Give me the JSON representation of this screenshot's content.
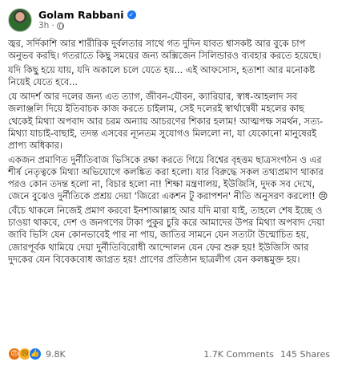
{
  "post": {
    "author": "Golam Rabbani",
    "time": "3h",
    "separator": "·",
    "verified_mark": "✓",
    "paragraphs": [
      "জ্বর, সর্দিকাশি আর শারীরিক দুর্বলতার সাথে গত দুদিন যাবত শ্বাসকষ্ট আর বুকে চাপ অনুভব করছি। গতরাতে কিছু সময়ের জন্য অক্সিজেন সিলিন্ডারও ব্যবহার করতে হয়েছে।",
      "যদি কিছু হয়ে যায়, যদি অকালে চলে যেতে হয়... এই আফসোস, হতাশা আর মনোকষ্ট নিয়েই যেতে হবে...",
      "যে আদর্শ আর দলের জন্য এত ত্যাগ, জীবন-যৌবন, ক্যারিয়ার, স্বাধ-আহলাদ সব জলাঞ্জলি দিয়ে ইতিবাচক কাজ করতে চাইলাম, সেই দলেরই স্বার্থান্বেষী মহলের কাছ থেকেই মিথ্যা অপবাদ আর চরম অন্যায় আচরণের শিকার হলাম! আত্মপক্ষ সমর্থন, সত্য-মিথ্যা যাচাই-বাছাই, তদন্ত এসবের ন্যূনতম সুযোগও মিললো না, যা যেকোনো মানুষেরই প্রাপ্য অধিকার।",
      "একজন প্রমাণিত দুর্নীতিবাজ ভিসিকে রক্ষা করতে গিয়ে বিশ্বের বৃহত্তম ছাত্রসংগঠন ও এর শীর্ষ নেতৃত্বকে মিথ্যা অভিযোগে কলঙ্কিত করা হলো। যার বিরুদ্ধে সকল তথ্যপ্রমাণ থাকার পরও কোন তদন্ত হলো না, বিচার হলো না! শিক্ষা মন্ত্রণালয়, ইউজিসি, দুদক সব দেখে, জেনে বুঝেও দুর্নীতিকে প্রশ্রয় দেয়া 'জিরো একশন টু করাপশন' নীতি অনুসরণ করলো! 😢",
      "বেঁচে থাকলে নিজেই প্রমাণ করবো ইনশাআল্লাহ আর যদি মারা যাই, তাহলে শেষ ইচ্ছে ও চাওয়া থাকবে, দেশ ও জনগণের টাকা পুকুর চুরি করে আমাদের উপর মিথ্যা অপবাদ দেয়া জাবি ভিসি যেন কোনভাবেই পার না পায়, জাতির সামনে যেন সত্যটা উন্মোচিত হয়, জোরপূর্বক থামিয়ে দেয়া দুর্নীতিবিরোধী আন্দোলন যেন ফের শুরু হয়! ইউজিসি আর দুদকের যেন বিবেকবোধ জাগ্রত হয়! প্রাণের প্রতিষ্ঠান ছাত্রলীগ যেন কলঙ্কমুক্ত হয়।"
    ]
  },
  "footer": {
    "reaction_icons": [
      "angry-icon",
      "sad-icon",
      "like-icon"
    ],
    "reaction_glyphs": [
      "😠",
      "😢",
      "👍"
    ],
    "reaction_count": "9.8K",
    "comments": "1.7K Comments",
    "shares": "145 Shares"
  },
  "colors": {
    "text": "#1c1e21",
    "muted": "#65676b",
    "brand_blue": "#1877f2",
    "angry": "#e9710f",
    "sad": "#f7b125"
  }
}
